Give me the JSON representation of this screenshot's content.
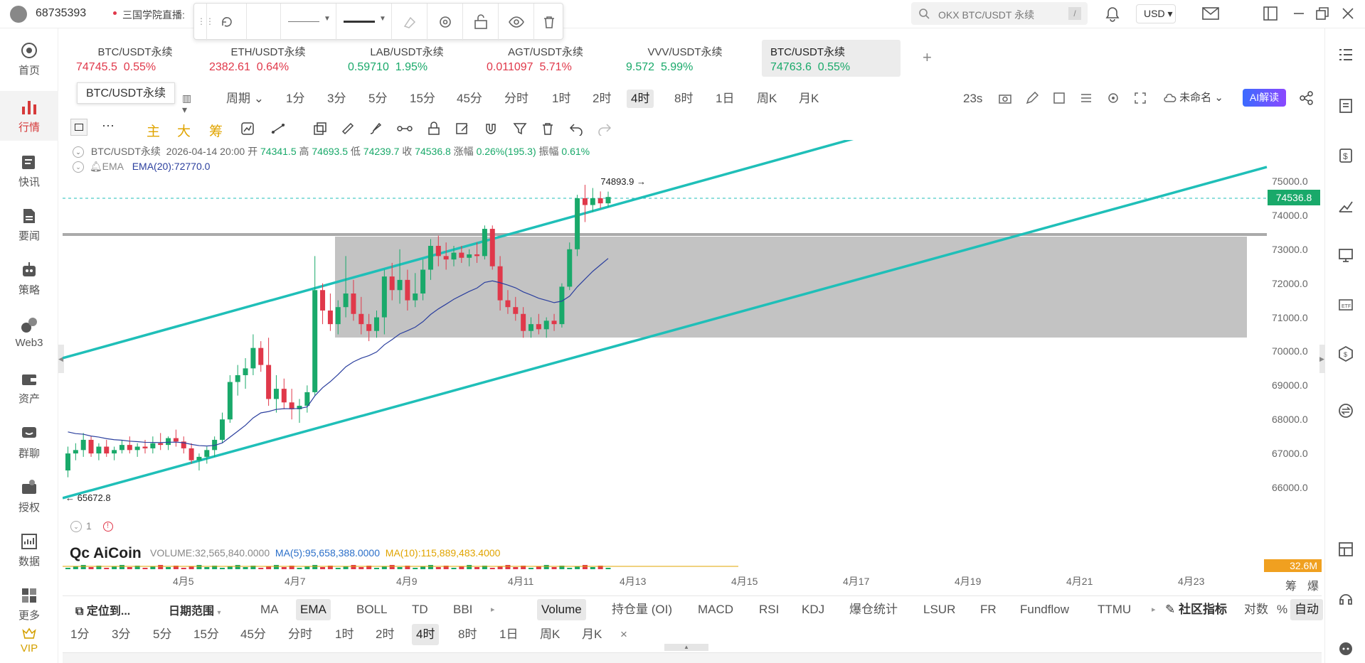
{
  "topbar": {
    "user_id": "68735393",
    "broadcast": "三国学院直播:",
    "search_placeholder": "OKX BTC/USDT 永续",
    "search_key": "/",
    "currency": "USD"
  },
  "sidebar": {
    "items": [
      {
        "label": "首页",
        "icon": "home-icon"
      },
      {
        "label": "行情",
        "icon": "market-chart-icon"
      },
      {
        "label": "快讯",
        "icon": "flash-news-icon"
      },
      {
        "label": "要闻",
        "icon": "news-icon"
      },
      {
        "label": "策略",
        "icon": "robot-icon"
      },
      {
        "label": "Web3",
        "icon": "web3-icon"
      },
      {
        "label": "资产",
        "icon": "wallet-icon"
      },
      {
        "label": "群聊",
        "icon": "chat-icon"
      },
      {
        "label": "授权",
        "icon": "auth-icon"
      },
      {
        "label": "数据",
        "icon": "data-icon"
      },
      {
        "label": "更多",
        "icon": "more-apps-icon"
      },
      {
        "label": "VIP",
        "icon": "vip-crown-icon"
      }
    ]
  },
  "tabs": [
    {
      "name": "BTC/USDT永续",
      "price": "74745.5",
      "change": "0.55%",
      "dir": "dn"
    },
    {
      "name": "ETH/USDT永续",
      "price": "2382.61",
      "change": "0.64%",
      "dir": "dn"
    },
    {
      "name": "LAB/USDT永续",
      "price": "0.59710",
      "change": "1.95%",
      "dir": "up"
    },
    {
      "name": "AGT/USDT永续",
      "price": "0.011097",
      "change": "5.71%",
      "dir": "dn"
    },
    {
      "name": "VVV/USDT永续",
      "price": "9.572",
      "change": "5.99%",
      "dir": "up"
    },
    {
      "name": "BTC/USDT永续",
      "price": "74763.6",
      "change": "0.55%",
      "dir": "up"
    }
  ],
  "tooltip": "BTC/USDT永续",
  "timeframes": {
    "period_label": "周期",
    "items": [
      "1分",
      "3分",
      "5分",
      "15分",
      "45分",
      "分时",
      "1时",
      "2时",
      "4时",
      "8时",
      "1日",
      "周K",
      "月K"
    ],
    "selected": "4时"
  },
  "toolbar_right": {
    "countdown": "23s",
    "layout_name": "未命名",
    "ai_label": "AI解读"
  },
  "draw_tools": {
    "main": "主",
    "big": "大",
    "chip": "筹"
  },
  "ohlc": {
    "symbol": "BTC/USDT永续",
    "time": "2026-04-14 20:00",
    "open_label": "开",
    "open": "74341.5",
    "high_label": "高",
    "high": "74693.5",
    "low_label": "低",
    "low": "74239.7",
    "close_label": "收",
    "close": "74536.8",
    "chg_label": "涨幅",
    "chg": "0.26%(195.3)",
    "amp_label": "振幅",
    "amp": "0.61%"
  },
  "ema": {
    "label": "EMA",
    "value": "EMA(20):72770.0"
  },
  "markers": {
    "high": "74893.9",
    "low": "65672.8",
    "current": "74536.8"
  },
  "yaxis": [
    "75000.0",
    "74000.0",
    "73000.0",
    "72000.0",
    "71000.0",
    "70000.0",
    "69000.0",
    "68000.0",
    "67000.0",
    "66000.0"
  ],
  "xaxis": [
    "4月5",
    "4月7",
    "4月9",
    "4月11",
    "4月13",
    "4月15",
    "4月17",
    "4月19",
    "4月21",
    "4月23"
  ],
  "volume": {
    "count": "1",
    "logo": "AiCoin",
    "text": "VOLUME:32,565,840.0000",
    "ma5": "MA(5):95,658,388.0000",
    "ma10": "MA(10):115,889,483.4000",
    "last": "32.6M"
  },
  "axis_corner": {
    "a": "筹",
    "b": "爆"
  },
  "bottom": {
    "locate": "定位到...",
    "date_range": "日期范围",
    "indicators": [
      "MA",
      "EMA",
      "BOLL",
      "TD",
      "BBI"
    ],
    "ind_selected": "EMA",
    "sub": [
      "Volume",
      "持仓量 (OI)",
      "MACD",
      "RSI",
      "KDJ",
      "爆仓统计",
      "LSUR",
      "FR",
      "Fundflow",
      "TTMU"
    ],
    "sub_selected": "Volume",
    "community": "社区指标",
    "log": "对数",
    "pct": "%",
    "auto": "自动"
  },
  "tf2": [
    "1分",
    "3分",
    "5分",
    "15分",
    "45分",
    "分时",
    "1时",
    "2时",
    "4时",
    "8时",
    "1日",
    "周K",
    "月K"
  ],
  "tf2_selected": "4时",
  "tf2_close": "×",
  "colors": {
    "up": "#19a96a",
    "down": "#e0384a",
    "channel": "#1fbfb8",
    "ema": "#2b3f9e",
    "zone": "#bfbfbf",
    "accent": "#d63a3a"
  }
}
